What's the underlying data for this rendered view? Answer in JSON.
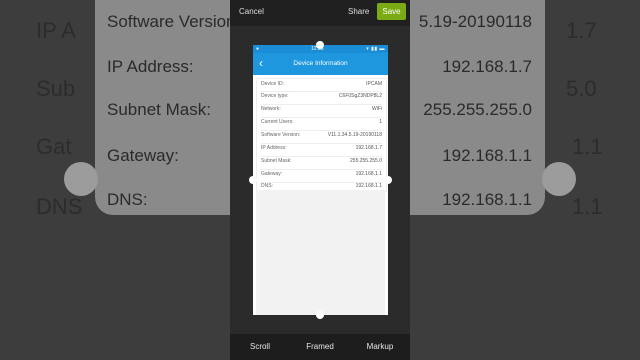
{
  "background": {
    "rows": [
      {
        "label": "Software Version:",
        "value": "5.19-20190118"
      },
      {
        "label": "IP Address:",
        "value": "192.168.1.7"
      },
      {
        "label": "Subnet Mask:",
        "value": "255.255.255.0"
      },
      {
        "label": "Gateway:",
        "value": "192.168.1.1"
      },
      {
        "label": "DNS:",
        "value": "192.168.1.1"
      }
    ],
    "left_edge": [
      "IP A",
      "Sub",
      "Gat",
      "DNS"
    ],
    "right_edge": [
      "1.7",
      "5.0",
      "1.1",
      "1.1"
    ]
  },
  "toolbar": {
    "cancel_label": "Cancel",
    "share_label": "Share",
    "save_label": "Save"
  },
  "phone": {
    "status_time": "12:38",
    "app_title": "Device Information",
    "rows": [
      {
        "label": "Device ID:",
        "value": "IPCAM"
      },
      {
        "label": "Device type:",
        "value": "C6F0SgZ3NDP8L2"
      },
      {
        "label": "Network:",
        "value": "WiFi"
      },
      {
        "label": "Current Users:",
        "value": "1"
      },
      {
        "label": "Software Version:",
        "value": "V11.1.34.5.19-20190118"
      },
      {
        "label": "IP Address:",
        "value": "192.168.1.7"
      },
      {
        "label": "Subnet Mask:",
        "value": "255.255.255.0"
      },
      {
        "label": "Gateway:",
        "value": "192.168.1.1"
      },
      {
        "label": "DNS:",
        "value": "192.168.1.1"
      }
    ]
  },
  "bottom_tabs": {
    "scroll": "Scroll",
    "framed": "Framed",
    "markup": "Markup"
  },
  "colors": {
    "accent": "#7aab14",
    "app_bar": "#1f97df"
  }
}
